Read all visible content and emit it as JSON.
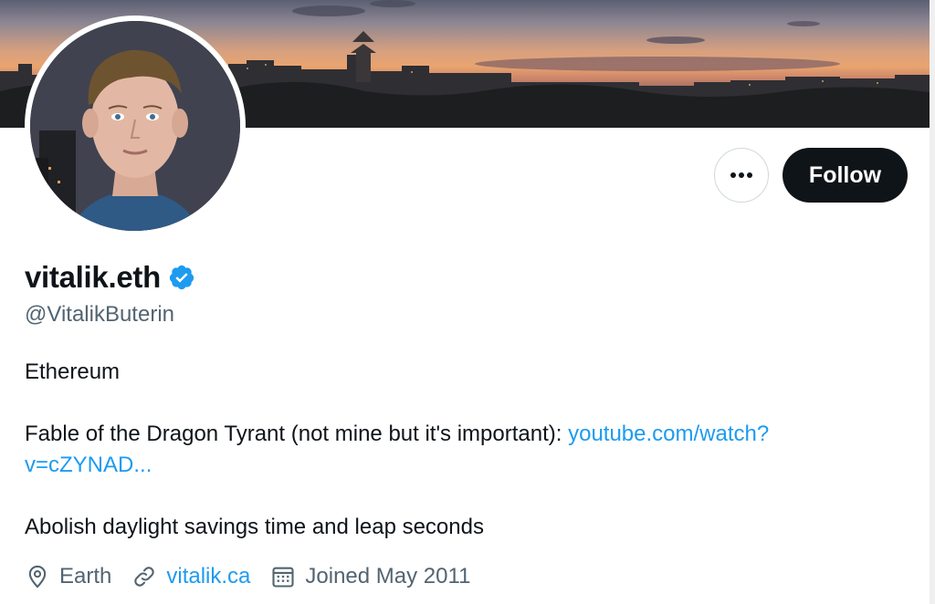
{
  "profile": {
    "display_name": "vitalik.eth",
    "handle": "@VitalikButerin",
    "verified": true
  },
  "actions": {
    "more_label": "•••",
    "follow_label": "Follow"
  },
  "bio": {
    "line1": "Ethereum",
    "line2_text": "Fable of the Dragon Tyrant (not mine but it's important): ",
    "line2_link_part1": "youtube.com/watch?",
    "line2_link_part2": "v=cZYNAD...",
    "line3": "Abolish daylight savings time and leap seconds"
  },
  "meta": {
    "location": "Earth",
    "website": "vitalik.ca",
    "joined": "Joined May 2011"
  },
  "icons": {
    "location": "location-pin-icon",
    "website": "link-icon",
    "joined": "calendar-icon",
    "verified": "verified-badge-icon"
  },
  "colors": {
    "link": "#1d9bf0",
    "secondary_text": "#536471",
    "follow_bg": "#0f1419",
    "verified": "#1d9bf0"
  }
}
